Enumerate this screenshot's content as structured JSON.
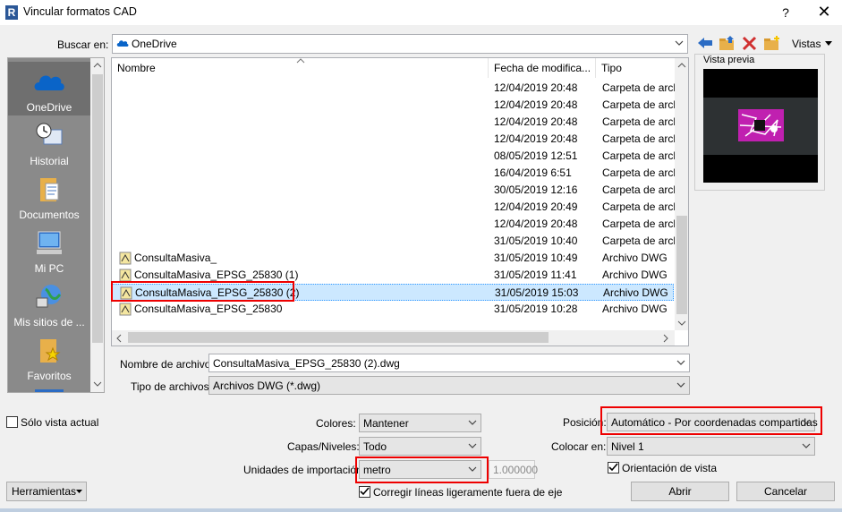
{
  "window": {
    "title": "Vincular formatos CAD",
    "app_icon": "R",
    "help": "?",
    "close": "✕"
  },
  "lookin": {
    "label": "Buscar en:",
    "value": "OneDrive"
  },
  "toolbar": {
    "views_label": "Vistas"
  },
  "places": [
    {
      "label": "OneDrive",
      "icon": "onedrive-icon"
    },
    {
      "label": "Historial",
      "icon": "history-icon"
    },
    {
      "label": "Documentos",
      "icon": "documents-icon"
    },
    {
      "label": "Mi PC",
      "icon": "computer-icon"
    },
    {
      "label": "Mis sitios de ...",
      "icon": "network-icon"
    },
    {
      "label": "Favoritos",
      "icon": "favorites-icon"
    }
  ],
  "columns": {
    "name": "Nombre",
    "date": "Fecha de modifica...",
    "type": "Tipo"
  },
  "files": [
    {
      "name": "",
      "date": "12/04/2019 20:48",
      "type": "Carpeta de archivos"
    },
    {
      "name": "",
      "date": "12/04/2019 20:48",
      "type": "Carpeta de archivos"
    },
    {
      "name": "",
      "date": "12/04/2019 20:48",
      "type": "Carpeta de archivos"
    },
    {
      "name": "",
      "date": "12/04/2019 20:48",
      "type": "Carpeta de archivos"
    },
    {
      "name": "",
      "date": "08/05/2019 12:51",
      "type": "Carpeta de archivos"
    },
    {
      "name": "",
      "date": "16/04/2019 6:51",
      "type": "Carpeta de archivos"
    },
    {
      "name": "",
      "date": "30/05/2019 12:16",
      "type": "Carpeta de archivos"
    },
    {
      "name": "",
      "date": "12/04/2019 20:49",
      "type": "Carpeta de archivos"
    },
    {
      "name": "",
      "date": "12/04/2019 20:48",
      "type": "Carpeta de archivos"
    },
    {
      "name": "",
      "date": "31/05/2019 10:40",
      "type": "Carpeta de archivos"
    },
    {
      "name": "ConsultaMasiva_",
      "date": "31/05/2019 10:49",
      "type": "Archivo DWG"
    },
    {
      "name": "ConsultaMasiva_EPSG_25830 (1)",
      "date": "31/05/2019 11:41",
      "type": "Archivo DWG"
    },
    {
      "name": "ConsultaMasiva_EPSG_25830 (2)",
      "date": "31/05/2019 15:03",
      "type": "Archivo DWG"
    },
    {
      "name": "ConsultaMasiva_EPSG_25830",
      "date": "31/05/2019 10:28",
      "type": "Archivo DWG"
    }
  ],
  "preview": {
    "label": "Vista previa"
  },
  "filename": {
    "label": "Nombre de archivo:",
    "value": "ConsultaMasiva_EPSG_25830 (2).dwg"
  },
  "filetype": {
    "label": "Tipo de archivos:",
    "value": "Archivos DWG  (*.dwg)"
  },
  "options": {
    "current_view_only": "Sólo vista actual",
    "colors_label": "Colores:",
    "colors_value": "Mantener",
    "layers_label": "Capas/Niveles:",
    "layers_value": "Todo",
    "units_label": "Unidades de importación:",
    "units_value": "metro",
    "scale_value": "1.000000",
    "correct_lines": "Corregir líneas ligeramente fuera de eje",
    "position_label": "Posición:",
    "position_value": "Automático - Por coordenadas compartidas",
    "place_at_label": "Colocar en:",
    "place_at_value": "Nivel 1",
    "orient_to_view": "Orientación de vista"
  },
  "buttons": {
    "tools": "Herramientas",
    "open": "Abrir",
    "cancel": "Cancelar"
  },
  "colors": {
    "accent": "#0078d7",
    "highlight": "#e00000",
    "selection": "#cce8ff"
  }
}
